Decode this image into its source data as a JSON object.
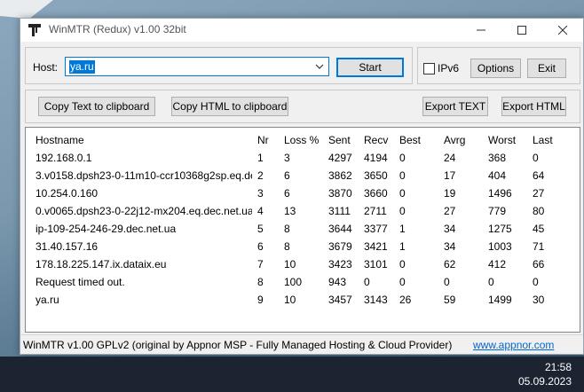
{
  "window": {
    "title": "WinMTR (Redux) v1.00 32bit"
  },
  "host": {
    "label": "Host:",
    "value": "ya.ru"
  },
  "buttons": {
    "start": "Start",
    "options": "Options",
    "exit": "Exit",
    "copy_text": "Copy Text to clipboard",
    "copy_html": "Copy HTML to clipboard",
    "export_text": "Export TEXT",
    "export_html": "Export HTML"
  },
  "ipv6": {
    "label": "IPv6",
    "checked": false
  },
  "table": {
    "columns": [
      "Hostname",
      "Nr",
      "Loss %",
      "Sent",
      "Recv",
      "Best",
      "Avrg",
      "Worst",
      "Last"
    ],
    "rows": [
      [
        "192.168.0.1",
        "1",
        "3",
        "4297",
        "4194",
        "0",
        "24",
        "368",
        "0"
      ],
      [
        "3.v0158.dpsh23-0-11m10-ccr10368g2sp.eq.dec....",
        "2",
        "6",
        "3862",
        "3650",
        "0",
        "17",
        "404",
        "64"
      ],
      [
        "10.254.0.160",
        "3",
        "6",
        "3870",
        "3660",
        "0",
        "19",
        "1496",
        "27"
      ],
      [
        "0.v0065.dpsh23-0-22j12-mx204.eq.dec.net.ua",
        "4",
        "13",
        "3111",
        "2711",
        "0",
        "27",
        "779",
        "80"
      ],
      [
        "ip-109-254-246-29.dec.net.ua",
        "5",
        "8",
        "3644",
        "3377",
        "1",
        "34",
        "1275",
        "45"
      ],
      [
        "31.40.157.16",
        "6",
        "8",
        "3679",
        "3421",
        "1",
        "34",
        "1003",
        "71"
      ],
      [
        "178.18.225.147.ix.dataix.eu",
        "7",
        "10",
        "3423",
        "3101",
        "0",
        "62",
        "412",
        "66"
      ],
      [
        "Request timed out.",
        "8",
        "100",
        "943",
        "0",
        "0",
        "0",
        "0",
        "0"
      ],
      [
        "ya.ru",
        "9",
        "10",
        "3457",
        "3143",
        "26",
        "59",
        "1499",
        "30"
      ]
    ]
  },
  "statusbar": {
    "text": "WinMTR v1.00 GPLv2 (original by Appnor MSP - Fully Managed Hosting & Cloud Provider)",
    "link": "www.appnor.com"
  },
  "taskbar": {
    "time": "21:58",
    "date": "05.09.2023"
  }
}
